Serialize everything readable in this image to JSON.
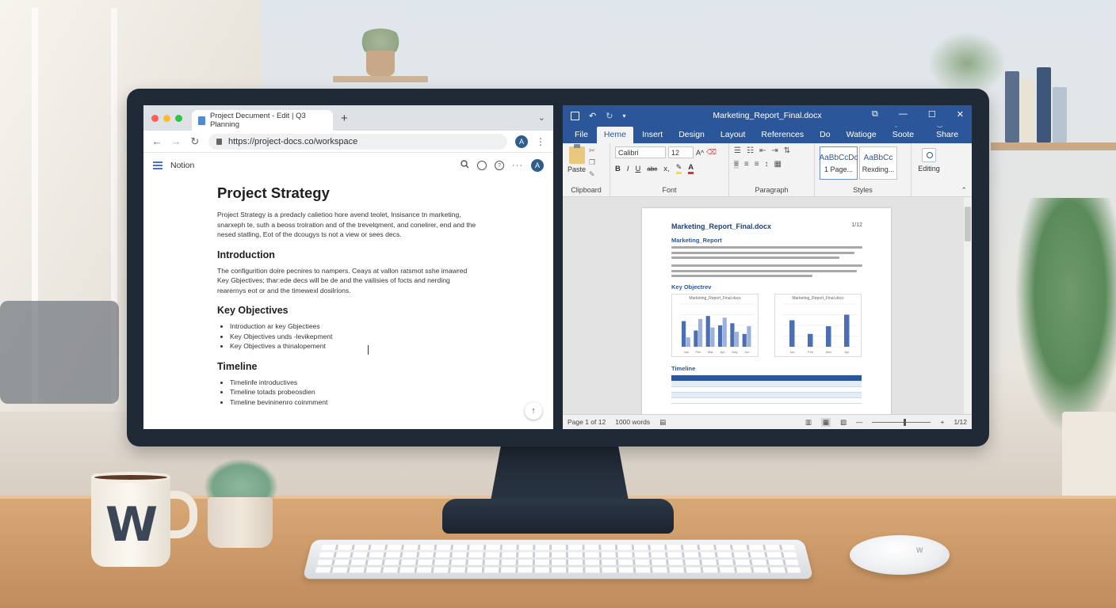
{
  "browser": {
    "tab_title": "Project Decument - Edit | Q3 Planning",
    "new_tab": "+",
    "tab_menu": "⌄",
    "url": "https://project-docs.co/workspace",
    "avatar_letter": "A",
    "nav": {
      "back": "←",
      "forward": "→",
      "reload": "↻",
      "more": "⋮"
    }
  },
  "notion": {
    "app_name": "Notion",
    "avatar_letter": "A",
    "more": "···"
  },
  "doc": {
    "title": "Project Strategy",
    "intro_para": "Project Strategy is a predacly calietioo hore avend teolet, Insisance tn marketing, snarxeph te, suth a beoss trolration and of the trevelqment, and conelirer, end and the nesed statling, Eot of the dcougys ts not a view or sees decs.",
    "sections": [
      {
        "heading": "Introduction",
        "text": "The configurition doire pecnires to nampers. Ceays at vallon ratsmot sshe imawred Key Gbjectives; thar:ede decs will be de and the vailisies of focts and nerding rearernys eot or and the timewexl dosilrions."
      },
      {
        "heading": "Key Objectives",
        "items": [
          "Introduction ar key Gbjectiees",
          "Key Objectives unds -levikepment",
          "Key Objectives a thinalopement"
        ]
      },
      {
        "heading": "Timeline",
        "items": [
          "Timelinfe introductives",
          "Timeline totads probeosdien",
          "Timeline bevininenro coinmment"
        ]
      }
    ],
    "scroll_top": "↑"
  },
  "word": {
    "doc_title": "Marketing_Report_Final.docx",
    "window_controls": [
      "⧉",
      "—",
      "☐",
      "✕"
    ],
    "qat": {
      "undo": "↶",
      "redo": "↻",
      "more": "▾"
    },
    "tabs": [
      "File",
      "Heme",
      "Insert",
      "Design",
      "Layout",
      "References",
      "Do",
      "Watioge",
      "Soote",
      "Share"
    ],
    "active_tab": "Heme",
    "ribbon": {
      "paste_label": "Paste",
      "clipboard_label": "Clipboard",
      "font_name": "Calibri",
      "font_size": "12",
      "font_label": "Font",
      "paragraph_label": "Paragraph",
      "styles_label": "Styles",
      "style1_sample": "AaBbCcDc",
      "style1_name": "1 Page...",
      "style2_sample": "AaBbCc",
      "style2_name": "Rexding...",
      "editing_label": "Editing",
      "bold": "B",
      "italic": "I",
      "underline": "U",
      "strike": "abc",
      "subscript": "x,",
      "grow_font": "A^"
    },
    "page": {
      "title": "Marketing_Report_Final.docx",
      "page_num": "1/12",
      "heading1": "Marketing_Report",
      "heading2": "Key Objectrev",
      "heading3": "Timeline",
      "chart1_caption": "Marketing_Report_Final.docx",
      "chart2_caption": "Marketing_Report_Final.docx"
    },
    "status": {
      "page": "Page 1 of 12",
      "words": "1000 words",
      "zoom_minus": "—",
      "zoom_plus": "+",
      "page_right": "1/12"
    }
  },
  "desk": {
    "mug_letter": "W",
    "mouse_logo": "W"
  },
  "chart_data": [
    {
      "type": "bar",
      "title": "Marketing_Report_Final.docx",
      "categories": [
        "Jan",
        "Feb",
        "Mar",
        "Apr",
        "May",
        "Jun"
      ],
      "series": [
        {
          "values": [
            60,
            38,
            72,
            50,
            55,
            30
          ]
        },
        {
          "values": [
            22,
            65,
            45,
            68,
            35,
            48
          ]
        }
      ],
      "ylim": [
        0,
        100
      ]
    },
    {
      "type": "bar",
      "title": "Marketing_Report_Final.docx",
      "categories": [
        "Jan",
        "Feb",
        "Mar",
        "Apr"
      ],
      "values": [
        62,
        30,
        48,
        75
      ],
      "ylim": [
        0,
        100
      ]
    }
  ]
}
